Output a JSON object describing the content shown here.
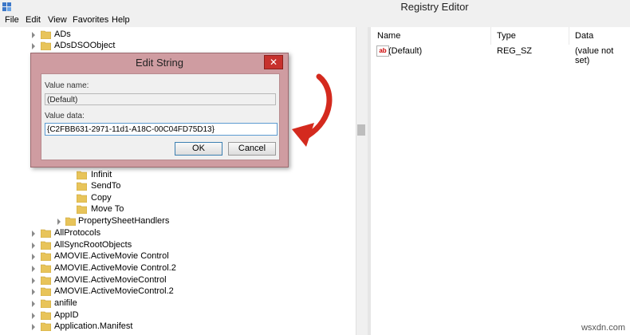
{
  "window": {
    "title": "Registry Editor",
    "app_icon": "registry-icon"
  },
  "menu": [
    "File",
    "Edit",
    "View",
    "Favorites",
    "Help"
  ],
  "tree": {
    "top_nodes": [
      "ADs",
      "ADsDSOObject"
    ],
    "sub_nodes": [
      "Infinit",
      "SendTo",
      "Copy",
      "Move To"
    ],
    "property_node": "PropertySheetHandlers",
    "bottom_nodes": [
      "AllProtocols",
      "AllSyncRootObjects",
      "AMOVIE.ActiveMovie Control",
      "AMOVIE.ActiveMovie Control.2",
      "AMOVIE.ActiveMovieControl",
      "AMOVIE.ActiveMovieControl.2",
      "anifile",
      "AppID",
      "Application.Manifest"
    ]
  },
  "list": {
    "columns": [
      "Name",
      "Type",
      "Data"
    ],
    "rows": [
      {
        "name": "(Default)",
        "type": "REG_SZ",
        "data": "(value not set)"
      }
    ]
  },
  "dialog": {
    "title": "Edit String",
    "close_glyph": "✕",
    "value_name_label": "Value name:",
    "value_name": "(Default)",
    "value_data_label": "Value data:",
    "value_data": "{C2FBB631-2971-11d1-A18C-00C04FD75D13}",
    "ok_label": "OK",
    "cancel_label": "Cancel"
  },
  "colors": {
    "dialog_frame": "#cf9ca1",
    "close_button": "#c7312d",
    "annotation_arrow": "#d42a1e",
    "folder": "#e8c45a"
  },
  "watermark": "wsxdn.com"
}
